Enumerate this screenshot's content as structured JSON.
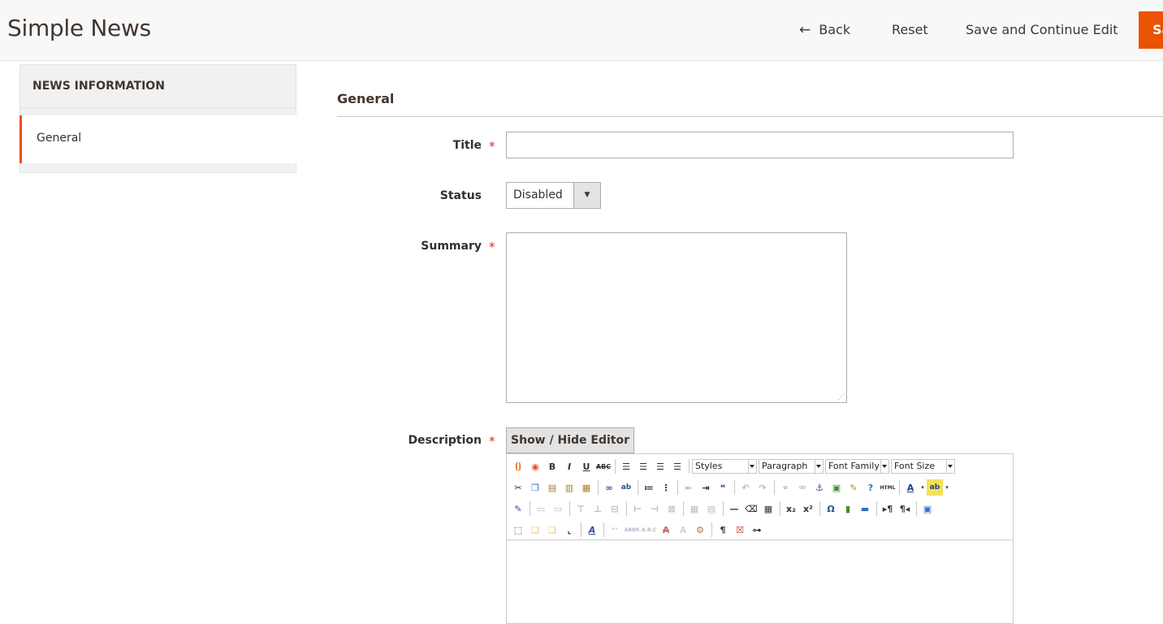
{
  "header": {
    "title": "Simple News",
    "back_label": "Back",
    "reset_label": "Reset",
    "save_continue_label": "Save and Continue Edit",
    "save_label": "Save"
  },
  "sidebar": {
    "heading": "NEWS INFORMATION",
    "items": [
      {
        "label": "General",
        "active": true
      }
    ]
  },
  "form": {
    "section_title": "General",
    "fields": {
      "title": {
        "label": "Title",
        "value": "",
        "required": true
      },
      "status": {
        "label": "Status",
        "value": "Disabled"
      },
      "summary": {
        "label": "Summary",
        "value": "",
        "required": true
      },
      "description": {
        "label": "Description",
        "required": true,
        "toggle_label": "Show / Hide Editor"
      }
    },
    "editor_dropdowns": {
      "styles": "Styles",
      "paragraph": "Paragraph",
      "font_family": "Font Family",
      "font_size": "Font Size"
    }
  },
  "colors": {
    "accent": "#eb5202",
    "required": "#e22626"
  }
}
